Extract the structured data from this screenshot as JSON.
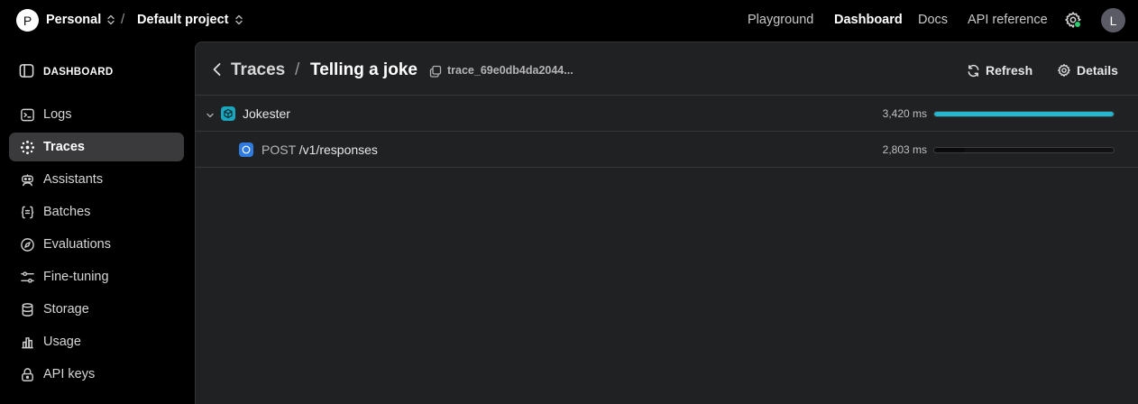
{
  "topbar": {
    "org_initial": "P",
    "org_name": "Personal",
    "separator": "/",
    "project_name": "Default project",
    "nav": [
      "Playground",
      "Dashboard",
      "Docs",
      "API reference"
    ],
    "active_nav": "Dashboard",
    "user_initial": "L",
    "status_color": "#2ecc71"
  },
  "sidebar": {
    "header": "DASHBOARD",
    "items": [
      {
        "label": "Logs",
        "icon": "terminal-icon"
      },
      {
        "label": "Traces",
        "icon": "traces-icon",
        "active": true
      },
      {
        "label": "Assistants",
        "icon": "robot-icon"
      },
      {
        "label": "Batches",
        "icon": "braces-icon"
      },
      {
        "label": "Evaluations",
        "icon": "compass-icon"
      },
      {
        "label": "Fine-tuning",
        "icon": "sliders-icon"
      },
      {
        "label": "Storage",
        "icon": "database-icon"
      },
      {
        "label": "Usage",
        "icon": "bar-chart-icon"
      },
      {
        "label": "API keys",
        "icon": "lock-icon"
      }
    ]
  },
  "main": {
    "breadcrumb_parent": "Traces",
    "breadcrumb_sep": "/",
    "title": "Telling a joke",
    "trace_id": "trace_69e0db4da2044...",
    "refresh_label": "Refresh",
    "details_label": "Details",
    "spans": [
      {
        "method": "",
        "name": "Jokester",
        "duration": "3,420 ms",
        "icon": "agent-cube-icon",
        "icon_color": "#1aa6bd",
        "bar_start": 0.0,
        "bar_fraction": 1.0,
        "bar_color": "#22b8cf",
        "level": 0,
        "expanded": true
      },
      {
        "method": "POST",
        "name": "/v1/responses",
        "duration": "2,803 ms",
        "icon": "response-circle-icon",
        "icon_color": "#2f7be0",
        "bar_start": 0.0,
        "bar_fraction": 0.17,
        "bar_color": "#0a0a0a",
        "level": 1
      }
    ]
  }
}
